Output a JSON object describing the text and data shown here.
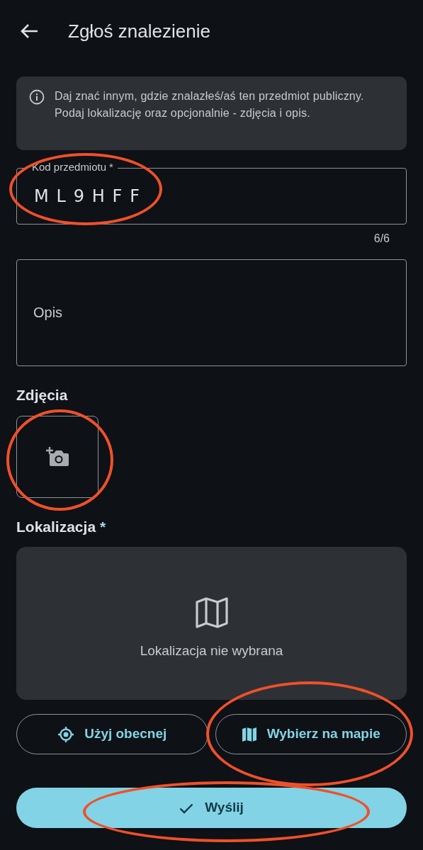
{
  "header": {
    "title": "Zgłoś znalezienie"
  },
  "info": {
    "text": "Daj znać innym, gdzie znalazłeś/aś ten przedmiot publiczny. Podaj lokalizację oraz opcjonalnie - zdjęcia i opis."
  },
  "code_field": {
    "label": "Kod przedmiotu",
    "required_mark": "*",
    "value": "ML9HFF",
    "counter": "6/6",
    "circled": true
  },
  "description_field": {
    "placeholder": "Opis"
  },
  "photos": {
    "heading": "Zdjęcia",
    "circled": true
  },
  "location": {
    "heading": "Lokalizacja",
    "required_mark": "*",
    "empty_text": "Lokalizacja nie wybrana"
  },
  "location_buttons": [
    {
      "label": "Użyj obecnej",
      "kind": "current",
      "circled": false
    },
    {
      "label": "Wybierz na mapie",
      "kind": "map",
      "circled": true
    }
  ],
  "submit": {
    "label": "Wyślij",
    "circled": true
  }
}
